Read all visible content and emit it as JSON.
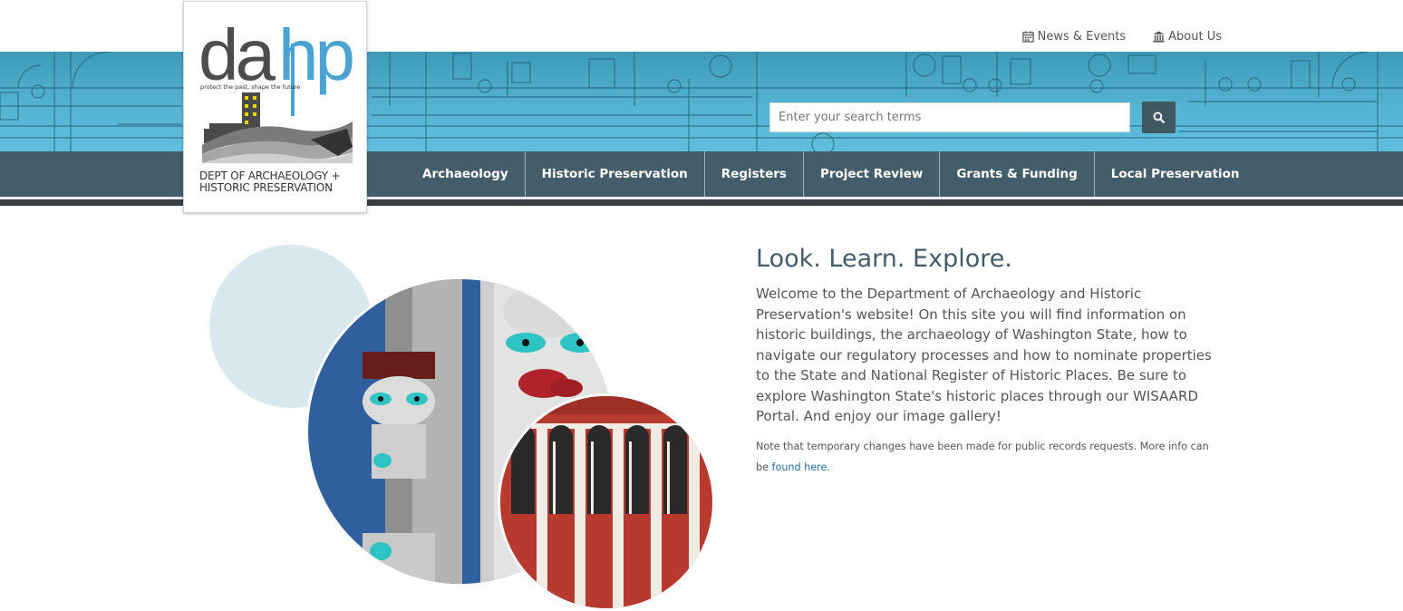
{
  "utility_links": [
    {
      "label": "News & Events",
      "icon": "calendar-icon"
    },
    {
      "label": "About Us",
      "icon": "building-icon"
    }
  ],
  "logo": {
    "wordmark": "dahp",
    "tagline": "protect the past, shape the future",
    "dept_line1": "DEPT OF ARCHAEOLOGY +",
    "dept_line2": "HISTORIC PRESERVATION"
  },
  "search": {
    "placeholder": "Enter your search terms",
    "button_icon": "search-icon"
  },
  "nav": {
    "items": [
      {
        "label": "Archaeology"
      },
      {
        "label": "Historic Preservation"
      },
      {
        "label": "Registers"
      },
      {
        "label": "Project Review"
      },
      {
        "label": "Grants & Funding"
      },
      {
        "label": "Local Preservation"
      }
    ]
  },
  "main": {
    "heading": "Look. Learn. Explore.",
    "intro": "Welcome to the Department of Archaeology and Historic Preservation's website! On this site you will find information on historic buildings, the archaeology of Washington State, how to navigate our regulatory processes and how to nominate properties to the State and National Register of Historic Places.  Be sure to explore Washington State's historic places through our WISAARD Portal. And enjoy our image gallery!",
    "note_prefix": "Note that temporary changes have been made for public records requests.  More info can be ",
    "note_link": "found here",
    "note_suffix": "."
  },
  "colors": {
    "nav_bg": "#435e6a",
    "banner_blue": "#55b3d2",
    "heading_color": "#435e6a",
    "link_color": "#2c6d9e",
    "logo_blue": "#4aa3d3"
  }
}
